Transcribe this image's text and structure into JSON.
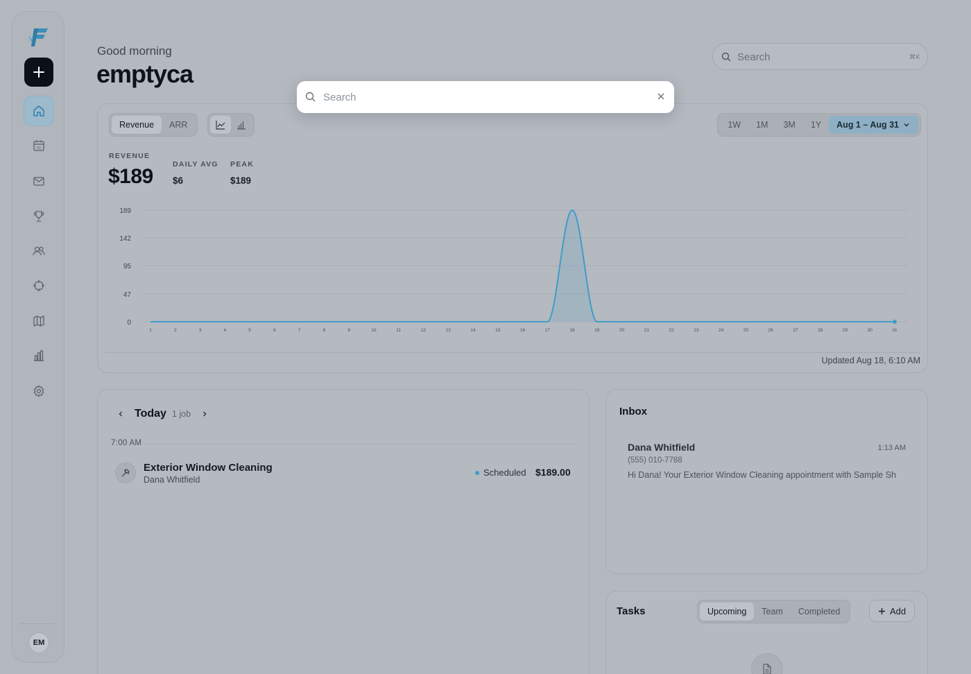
{
  "sidebar": {
    "logo_icon": "brand-f-logo",
    "add_icon": "plus-icon",
    "items": [
      {
        "name": "home",
        "icon": "home-icon",
        "active": true
      },
      {
        "name": "calendar",
        "icon": "calendar-icon",
        "active": false
      },
      {
        "name": "inbox",
        "icon": "mail-icon",
        "active": false
      },
      {
        "name": "rewards",
        "icon": "trophy-icon",
        "active": false
      },
      {
        "name": "clients",
        "icon": "users-icon",
        "active": false
      },
      {
        "name": "targets",
        "icon": "crosshair-icon",
        "active": false
      },
      {
        "name": "map",
        "icon": "map-icon",
        "active": false
      },
      {
        "name": "reports",
        "icon": "bar-chart-icon",
        "active": false
      },
      {
        "name": "settings",
        "icon": "gear-icon",
        "active": false
      }
    ],
    "avatar_initials": "EM"
  },
  "header": {
    "greeting": "Good morning",
    "username": "emptyca",
    "search_placeholder": "Search",
    "search_shortcut": "⌘K"
  },
  "search_modal": {
    "placeholder": "Search",
    "value": ""
  },
  "revenue_card": {
    "metric_tabs": [
      "Revenue",
      "ARR"
    ],
    "active_metric": "Revenue",
    "chart_type_icons": [
      "line-chart-icon",
      "bar-chart-icon"
    ],
    "ranges": [
      "1W",
      "1M",
      "3M",
      "1Y"
    ],
    "date_range": "Aug 1 – Aug 31",
    "stats": {
      "main_label": "REVENUE",
      "main_value": "$189",
      "daily_avg_label": "DAILY AVG",
      "daily_avg_value": "$6",
      "peak_label": "PEAK",
      "peak_value": "$189"
    },
    "updated": "Updated Aug 18, 6:10 AM",
    "accent_color": "#3f9dc7"
  },
  "chart_data": {
    "type": "area",
    "title": "",
    "xlabel": "",
    "ylabel": "",
    "x": [
      "1",
      "2",
      "3",
      "4",
      "5",
      "6",
      "7",
      "8",
      "9",
      "10",
      "11",
      "12",
      "13",
      "14",
      "15",
      "16",
      "17",
      "18",
      "19",
      "20",
      "21",
      "22",
      "23",
      "24",
      "25",
      "26",
      "27",
      "28",
      "29",
      "30",
      "31"
    ],
    "series": [
      {
        "values": [
          0,
          0,
          0,
          0,
          0,
          0,
          0,
          0,
          0,
          0,
          0,
          0,
          0,
          0,
          0,
          0,
          0,
          189,
          0,
          0,
          0,
          0,
          0,
          0,
          0,
          0,
          0,
          0,
          0,
          0,
          0
        ]
      }
    ],
    "yticks": [
      0,
      47,
      95,
      142,
      189
    ],
    "ylim": [
      0,
      189
    ],
    "grid": true,
    "smooth": true
  },
  "schedule": {
    "title": "Today",
    "job_count": "1 job",
    "time_label": "7:00 AM",
    "jobs": [
      {
        "title": "Exterior Window Cleaning",
        "client": "Dana Whitfield",
        "status": "Scheduled",
        "price": "$189.00",
        "icon": "hammer-icon"
      }
    ]
  },
  "inbox": {
    "title": "Inbox",
    "messages": [
      {
        "from": "Dana Whitfield",
        "time": "1:13 AM",
        "phone": "(555) 010-7788",
        "preview": "Hi Dana! Your Exterior Window Cleaning appointment with Sample Sh"
      }
    ]
  },
  "tasks": {
    "title": "Tasks",
    "tabs": [
      "Upcoming",
      "Team",
      "Completed"
    ],
    "active_tab": "Upcoming",
    "add_label": "Add"
  }
}
